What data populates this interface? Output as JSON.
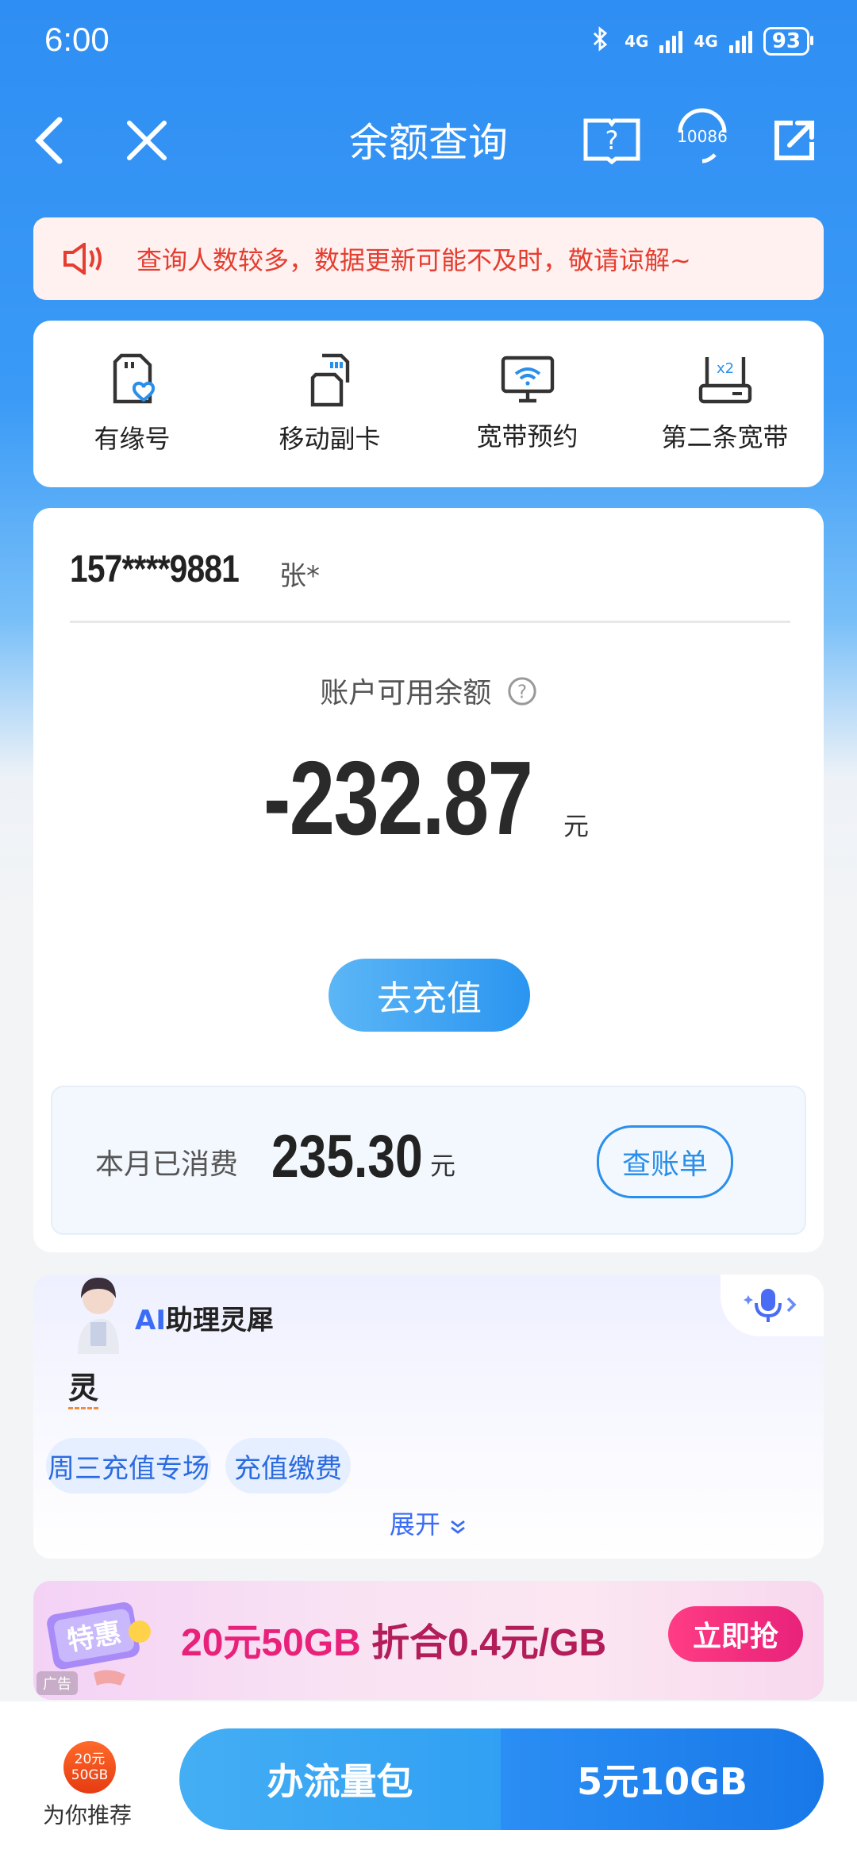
{
  "status_bar": {
    "time": "6:00",
    "network1": "4G",
    "network2": "4G",
    "battery": "93"
  },
  "nav": {
    "title": "余额查询",
    "service_number": "10086"
  },
  "notice": {
    "text": "查询人数较多，数据更新可能不及时，敬请谅解~"
  },
  "shortcuts": [
    {
      "label": "有缘号",
      "icon": "sim-heart-icon"
    },
    {
      "label": "移动副卡",
      "icon": "sim-card-icon"
    },
    {
      "label": "宽带预约",
      "icon": "broadband-monitor-icon"
    },
    {
      "label": "第二条宽带",
      "icon": "router-x2-icon",
      "badge": "x2"
    }
  ],
  "account": {
    "phone": "157****9881",
    "holder": "张*",
    "balance_label": "账户可用余额",
    "balance": "-232.87",
    "unit": "元",
    "topup_label": "去充值",
    "spent_label": "本月已消费",
    "spent": "235.30",
    "spent_unit": "元",
    "bill_label": "查账单"
  },
  "ai": {
    "title_prefix": "AI",
    "title_suffix": "助理灵犀",
    "char": "灵",
    "chips": [
      "周三充值专场",
      "充值缴费"
    ],
    "expand_label": "展开"
  },
  "ad": {
    "tag_text": "特惠",
    "headline": "20元50GB",
    "subline": "折合0.4元/GB",
    "cta": "立即抢",
    "ad_label": "广告"
  },
  "bottom": {
    "badge_line1": "20元",
    "badge_line2": "50GB",
    "recommend_label": "为你推荐",
    "cta_left": "办流量包",
    "cta_right": "5元10GB"
  }
}
